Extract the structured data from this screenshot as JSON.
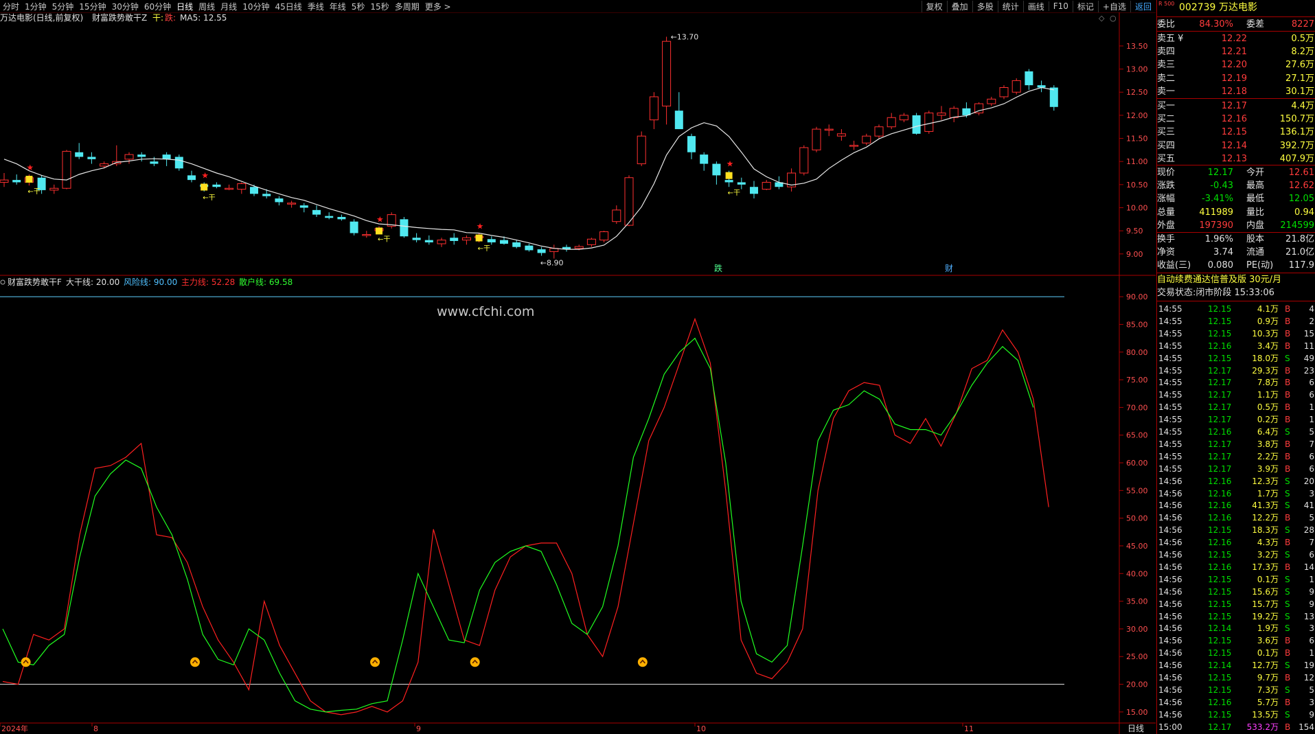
{
  "toolbar": {
    "periods": [
      "分时",
      "1分钟",
      "5分钟",
      "15分钟",
      "30分钟",
      "60分钟",
      "日线",
      "周线",
      "月线",
      "10分钟",
      "45日线",
      "季线",
      "年线",
      "5秒",
      "15秒",
      "多周期",
      "更多 >"
    ],
    "active_period": "日线",
    "tools": [
      "复权",
      "叠加",
      "多股",
      "统计",
      "画线",
      "F10",
      "标记",
      "+自选",
      "返回"
    ]
  },
  "main_chart": {
    "title": "万达电影(日线,前复权)",
    "indicator_title": "财富跌势敢干Z",
    "gan_label": "干:",
    "dian_label": "跌:",
    "ma_label": "MA5: 12.55",
    "high_label": "13.70",
    "low_label": "8.90",
    "signal_text": "干",
    "yticks": [
      "13.50",
      "13.00",
      "12.50",
      "12.00",
      "11.50",
      "11.00",
      "10.50",
      "10.00",
      "9.50",
      "9.00"
    ],
    "markers": [
      {
        "text": "跌",
        "color": "#50ff90"
      },
      {
        "text": "财",
        "color": "#50b0ff"
      }
    ]
  },
  "sub_chart": {
    "title": "财富跌势敢干F",
    "legend": [
      {
        "text": "大干线: 20.00",
        "color": "#e0e0e0"
      },
      {
        "text": "风险线: 90.00",
        "color": "#50c0ff"
      },
      {
        "text": "主力线: 52.28",
        "color": "#ff3030"
      },
      {
        "text": "散户线: 69.58",
        "color": "#30ff30"
      }
    ],
    "watermark": "www.cfchi.com",
    "yticks": [
      "90.00",
      "85.00",
      "80.00",
      "75.00",
      "70.00",
      "65.00",
      "60.00",
      "55.00",
      "50.00",
      "45.00",
      "40.00",
      "35.00",
      "30.00",
      "25.00",
      "20.00",
      "15.00"
    ],
    "xticks": [
      "2024年",
      "8",
      "9",
      "10",
      "11"
    ],
    "period_label": "日线"
  },
  "chart_data": {
    "type": "candlestick",
    "price_ylim": [
      8.7,
      13.9
    ],
    "candles": [
      [
        10.55,
        10.75,
        10.45,
        10.6
      ],
      [
        10.6,
        10.72,
        10.5,
        10.55
      ],
      [
        10.55,
        10.72,
        10.48,
        10.65
      ],
      [
        10.65,
        10.7,
        10.3,
        10.38
      ],
      [
        10.38,
        10.5,
        10.3,
        10.42
      ],
      [
        10.42,
        11.25,
        10.4,
        11.22
      ],
      [
        11.2,
        11.4,
        11.05,
        11.1
      ],
      [
        11.1,
        11.2,
        10.95,
        11.05
      ],
      [
        10.9,
        11.0,
        10.85,
        10.95
      ],
      [
        10.95,
        11.35,
        10.9,
        11.0
      ],
      [
        11.05,
        11.2,
        10.95,
        11.15
      ],
      [
        11.15,
        11.2,
        11.0,
        11.1
      ],
      [
        11.0,
        11.1,
        10.9,
        10.95
      ],
      [
        11.15,
        11.2,
        10.9,
        11.05
      ],
      [
        11.1,
        11.15,
        10.8,
        10.85
      ],
      [
        10.7,
        10.8,
        10.55,
        10.6
      ],
      [
        10.5,
        10.55,
        10.35,
        10.45
      ],
      [
        10.5,
        10.55,
        10.42,
        10.45
      ],
      [
        10.42,
        10.5,
        10.38,
        10.42
      ],
      [
        10.4,
        10.55,
        10.3,
        10.52
      ],
      [
        10.45,
        10.5,
        10.25,
        10.3
      ],
      [
        10.3,
        10.4,
        10.2,
        10.25
      ],
      [
        10.2,
        10.25,
        10.05,
        10.12
      ],
      [
        10.1,
        10.15,
        10.0,
        10.1
      ],
      [
        10.05,
        10.1,
        9.9,
        10.0
      ],
      [
        9.95,
        10.05,
        9.8,
        9.85
      ],
      [
        9.82,
        9.9,
        9.75,
        9.78
      ],
      [
        9.8,
        9.85,
        9.72,
        9.75
      ],
      [
        9.7,
        9.75,
        9.4,
        9.45
      ],
      [
        9.4,
        9.5,
        9.35,
        9.42
      ],
      [
        9.5,
        9.6,
        9.45,
        9.55
      ],
      [
        9.6,
        9.9,
        9.55,
        9.85
      ],
      [
        9.75,
        9.8,
        9.35,
        9.38
      ],
      [
        9.35,
        9.45,
        9.25,
        9.3
      ],
      [
        9.3,
        9.4,
        9.2,
        9.25
      ],
      [
        9.22,
        9.35,
        9.15,
        9.3
      ],
      [
        9.35,
        9.45,
        9.2,
        9.28
      ],
      [
        9.3,
        9.4,
        9.2,
        9.35
      ],
      [
        9.35,
        9.45,
        9.25,
        9.38
      ],
      [
        9.32,
        9.38,
        9.2,
        9.25
      ],
      [
        9.3,
        9.38,
        9.2,
        9.22
      ],
      [
        9.25,
        9.3,
        9.12,
        9.15
      ],
      [
        9.18,
        9.22,
        9.05,
        9.08
      ],
      [
        9.1,
        9.15,
        8.96,
        9.02
      ],
      [
        9.05,
        9.2,
        8.9,
        9.12
      ],
      [
        9.15,
        9.2,
        9.05,
        9.1
      ],
      [
        9.12,
        9.2,
        9.08,
        9.16
      ],
      [
        9.2,
        9.35,
        9.15,
        9.32
      ],
      [
        9.3,
        9.5,
        9.25,
        9.48
      ],
      [
        9.7,
        10.05,
        9.65,
        9.95
      ],
      [
        9.62,
        10.7,
        9.6,
        10.65
      ],
      [
        10.95,
        11.65,
        10.9,
        11.55
      ],
      [
        11.9,
        12.5,
        11.7,
        12.4
      ],
      [
        12.2,
        13.7,
        11.8,
        13.6
      ],
      [
        12.1,
        12.5,
        11.7,
        11.7
      ],
      [
        11.55,
        11.6,
        11.05,
        11.2
      ],
      [
        11.15,
        11.2,
        10.8,
        10.95
      ],
      [
        10.95,
        11.0,
        10.5,
        10.7
      ],
      [
        10.6,
        10.8,
        10.45,
        10.55
      ],
      [
        10.55,
        10.65,
        10.4,
        10.5
      ],
      [
        10.45,
        10.58,
        10.2,
        10.3
      ],
      [
        10.4,
        10.6,
        10.38,
        10.55
      ],
      [
        10.55,
        10.68,
        10.4,
        10.45
      ],
      [
        10.45,
        10.85,
        10.35,
        10.75
      ],
      [
        10.75,
        11.35,
        10.7,
        11.3
      ],
      [
        11.25,
        11.75,
        11.2,
        11.7
      ],
      [
        11.7,
        11.8,
        11.55,
        11.7
      ],
      [
        11.55,
        11.7,
        11.45,
        11.6
      ],
      [
        11.35,
        11.45,
        11.25,
        11.35
      ],
      [
        11.4,
        11.6,
        11.35,
        11.55
      ],
      [
        11.55,
        11.8,
        11.5,
        11.75
      ],
      [
        11.75,
        12.05,
        11.7,
        11.95
      ],
      [
        11.9,
        12.05,
        11.85,
        12.0
      ],
      [
        12.0,
        12.05,
        11.58,
        11.6
      ],
      [
        11.65,
        12.1,
        11.6,
        12.05
      ],
      [
        12.0,
        12.2,
        11.9,
        12.05
      ],
      [
        11.95,
        12.2,
        11.85,
        12.15
      ],
      [
        12.15,
        12.28,
        11.95,
        12.0
      ],
      [
        12.05,
        12.28,
        12.0,
        12.25
      ],
      [
        12.25,
        12.4,
        12.2,
        12.35
      ],
      [
        12.4,
        12.65,
        12.35,
        12.6
      ],
      [
        12.5,
        12.8,
        12.45,
        12.75
      ],
      [
        12.95,
        13.0,
        12.55,
        12.65
      ],
      [
        12.65,
        12.75,
        12.5,
        12.6
      ],
      [
        12.6,
        12.65,
        12.1,
        12.18
      ]
    ],
    "ma5": [
      11.05,
      10.95,
      10.8,
      10.7,
      10.62,
      10.6,
      10.72,
      10.8,
      10.86,
      10.98,
      11.01,
      11.05,
      11.06,
      11.05,
      11.03,
      10.95,
      10.85,
      10.75,
      10.67,
      10.57,
      10.47,
      10.38,
      10.3,
      10.22,
      10.16,
      10.07,
      9.98,
      9.9,
      9.82,
      9.72,
      9.65,
      9.63,
      9.6,
      9.57,
      9.55,
      9.53,
      9.52,
      9.46,
      9.45,
      9.4,
      9.36,
      9.3,
      9.24,
      9.17,
      9.12,
      9.1,
      9.1,
      9.13,
      9.19,
      9.38,
      9.68,
      10.02,
      10.52,
      11.14,
      11.54,
      11.73,
      11.84,
      11.77,
      11.54,
      11.2,
      10.84,
      10.67,
      10.55,
      10.49,
      10.53,
      10.62,
      10.85,
      11.03,
      11.19,
      11.31,
      11.49,
      11.6,
      11.68,
      11.76,
      11.82,
      11.88,
      11.96,
      11.99,
      12.1,
      12.16,
      12.25,
      12.39,
      12.52,
      12.6,
      12.55
    ],
    "sub_ylim": [
      13,
      92
    ],
    "main_line": [
      20.5,
      20.0,
      29.0,
      28.0,
      30.0,
      47.0,
      59.0,
      59.5,
      61.0,
      63.5,
      47.0,
      46.5,
      42.0,
      34.0,
      28.0,
      24.0,
      19.0,
      35.0,
      27.0,
      22.0,
      17.0,
      15.0,
      14.5,
      15.0,
      16.0,
      15.0,
      17.0,
      24.0,
      48.0,
      38.0,
      28.0,
      27.0,
      37.0,
      43.0,
      45.0,
      45.5,
      45.5,
      40.0,
      29.0,
      25.0,
      34.0,
      49.0,
      64.0,
      70.0,
      78.0,
      86.0,
      78.0,
      55.0,
      28.0,
      22.0,
      21.0,
      24.0,
      30.0,
      55.0,
      68.0,
      73.0,
      74.5,
      74.0,
      65.0,
      63.5,
      68.0,
      63.0,
      69.0,
      77.0,
      78.5,
      84.0,
      80.0,
      71.5,
      52.0
    ],
    "retail_line": [
      30.0,
      24.0,
      23.5,
      27.0,
      29.0,
      43.0,
      54.0,
      58.0,
      60.5,
      59.0,
      52.0,
      47.0,
      39.0,
      29.0,
      24.5,
      23.5,
      30.0,
      28.0,
      22.0,
      17.0,
      15.5,
      15.0,
      15.3,
      15.5,
      16.5,
      17.0,
      28.0,
      40.0,
      34.0,
      28.0,
      27.5,
      37.0,
      42.0,
      44.0,
      45.0,
      44.0,
      38.0,
      31.0,
      29.0,
      34.0,
      45.0,
      61.0,
      68.0,
      76.0,
      80.0,
      82.5,
      77.0,
      60.0,
      35.0,
      25.5,
      24.0,
      27.0,
      45.0,
      64.0,
      69.5,
      70.5,
      73.0,
      71.5,
      67.0,
      66.0,
      66.0,
      65.0,
      69.0,
      74.0,
      78.0,
      81.0,
      78.5,
      70.0
    ],
    "big_gan_line": 20.0,
    "risk_line": 90.0
  },
  "panel": {
    "code": "002739",
    "name": "万达电影",
    "badge": "R 500",
    "weibi_label": "委比",
    "weibi": "84.30%",
    "weicha_label": "委差",
    "weicha": "8227",
    "asks": [
      {
        "label": "卖五 ¥",
        "price": "12.22",
        "vol": "0.5万"
      },
      {
        "label": "卖四",
        "price": "12.21",
        "vol": "8.2万"
      },
      {
        "label": "卖三",
        "price": "12.20",
        "vol": "27.6万"
      },
      {
        "label": "卖二",
        "price": "12.19",
        "vol": "27.1万"
      },
      {
        "label": "卖一",
        "price": "12.18",
        "vol": "30.1万"
      }
    ],
    "bids": [
      {
        "label": "买一",
        "price": "12.17",
        "vol": "4.4万"
      },
      {
        "label": "买二",
        "price": "12.16",
        "vol": "150.7万"
      },
      {
        "label": "买三",
        "price": "12.15",
        "vol": "136.1万"
      },
      {
        "label": "买四",
        "price": "12.14",
        "vol": "392.7万"
      },
      {
        "label": "买五",
        "price": "12.13",
        "vol": "407.9万"
      }
    ],
    "stats": [
      {
        "l1": "现价",
        "v1": "12.17",
        "c1": "green",
        "l2": "今开",
        "v2": "12.61",
        "c2": "red"
      },
      {
        "l1": "涨跌",
        "v1": "-0.43",
        "c1": "green",
        "l2": "最高",
        "v2": "12.62",
        "c2": "red"
      },
      {
        "l1": "涨幅",
        "v1": "-3.41%",
        "c1": "green",
        "l2": "最低",
        "v2": "12.05",
        "c2": "green"
      },
      {
        "l1": "总量",
        "v1": "411989",
        "c1": "yellow",
        "l2": "量比",
        "v2": "0.94",
        "c2": "yellow"
      },
      {
        "l1": "外盘",
        "v1": "197390",
        "c1": "red",
        "l2": "内盘",
        "v2": "214599",
        "c2": "green"
      }
    ],
    "stats2": [
      {
        "l1": "换手",
        "v1": "1.96%",
        "l2": "股本",
        "v2": "21.8亿"
      },
      {
        "l1": "净资",
        "v1": "3.74",
        "l2": "流通",
        "v2": "21.0亿"
      },
      {
        "l1": "收益(三)",
        "v1": "0.080",
        "l2": "PE(动)",
        "v2": "117.9"
      }
    ],
    "ad": "自动续费通达信普及版 30元/月",
    "trade_state": "交易状态:闭市阶段 15:33:06",
    "ticks": [
      [
        "14:55",
        "12.15",
        "4.1万",
        "B",
        "4"
      ],
      [
        "14:55",
        "12.15",
        "0.9万",
        "B",
        "2"
      ],
      [
        "14:55",
        "12.15",
        "10.3万",
        "B",
        "15"
      ],
      [
        "14:55",
        "12.16",
        "3.4万",
        "B",
        "11"
      ],
      [
        "14:55",
        "12.15",
        "18.0万",
        "S",
        "49"
      ],
      [
        "14:55",
        "12.17",
        "29.3万",
        "B",
        "23"
      ],
      [
        "14:55",
        "12.17",
        "7.8万",
        "B",
        "6"
      ],
      [
        "14:55",
        "12.17",
        "1.1万",
        "B",
        "6"
      ],
      [
        "14:55",
        "12.17",
        "0.5万",
        "B",
        "1"
      ],
      [
        "14:55",
        "12.17",
        "0.2万",
        "B",
        "1"
      ],
      [
        "14:55",
        "12.16",
        "6.4万",
        "S",
        "5"
      ],
      [
        "14:55",
        "12.17",
        "3.8万",
        "B",
        "7"
      ],
      [
        "14:55",
        "12.17",
        "2.2万",
        "B",
        "6"
      ],
      [
        "14:55",
        "12.17",
        "3.9万",
        "B",
        "6"
      ],
      [
        "14:56",
        "12.16",
        "12.3万",
        "S",
        "20"
      ],
      [
        "14:56",
        "12.16",
        "1.7万",
        "S",
        "3"
      ],
      [
        "14:56",
        "12.16",
        "41.3万",
        "S",
        "41"
      ],
      [
        "14:56",
        "12.16",
        "12.2万",
        "B",
        "5"
      ],
      [
        "14:56",
        "12.15",
        "18.3万",
        "S",
        "28"
      ],
      [
        "14:56",
        "12.16",
        "4.3万",
        "B",
        "7"
      ],
      [
        "14:56",
        "12.15",
        "3.2万",
        "S",
        "6"
      ],
      [
        "14:56",
        "12.16",
        "17.3万",
        "B",
        "14"
      ],
      [
        "14:56",
        "12.15",
        "0.1万",
        "S",
        "1"
      ],
      [
        "14:56",
        "12.15",
        "15.6万",
        "S",
        "9"
      ],
      [
        "14:56",
        "12.15",
        "15.7万",
        "S",
        "9"
      ],
      [
        "14:56",
        "12.15",
        "19.2万",
        "S",
        "13"
      ],
      [
        "14:56",
        "12.14",
        "1.9万",
        "S",
        "3"
      ],
      [
        "14:56",
        "12.15",
        "3.6万",
        "B",
        "6"
      ],
      [
        "14:56",
        "12.15",
        "0.1万",
        "B",
        "1"
      ],
      [
        "14:56",
        "12.14",
        "12.7万",
        "S",
        "19"
      ],
      [
        "14:56",
        "12.15",
        "9.7万",
        "B",
        "12"
      ],
      [
        "14:56",
        "12.15",
        "7.3万",
        "S",
        "5"
      ],
      [
        "14:56",
        "12.16",
        "5.7万",
        "B",
        "3"
      ],
      [
        "14:56",
        "12.15",
        "13.5万",
        "S",
        "9"
      ],
      [
        "15:00",
        "12.17",
        "533.2万",
        "B",
        "154"
      ]
    ]
  }
}
